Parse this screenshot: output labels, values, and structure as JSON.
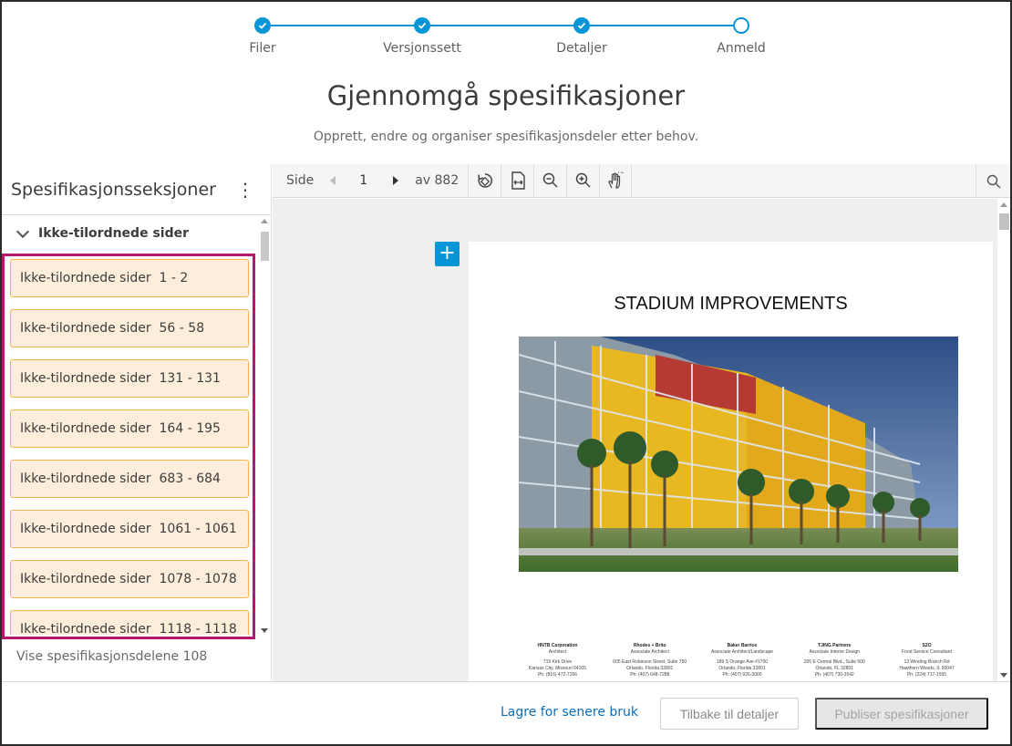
{
  "stepper": {
    "steps": [
      {
        "label": "Filer",
        "done": true
      },
      {
        "label": "Versjonssett",
        "done": true
      },
      {
        "label": "Detaljer",
        "done": true
      },
      {
        "label": "Anmeld",
        "done": false
      }
    ]
  },
  "header": {
    "title": "Gjennomgå spesifikasjoner",
    "subtitle": "Opprett, endre og organiser spesifikasjonsdeler etter behov."
  },
  "sidebar": {
    "title": "Spesifikasjonsseksjoner",
    "group_label": "Ikke-tilordnede sider",
    "items": [
      "Ikke-tilordnede sider  1 - 2",
      "Ikke-tilordnede sider  56 - 58",
      "Ikke-tilordnede sider  131 - 131",
      "Ikke-tilordnede sider  164 - 195",
      "Ikke-tilordnede sider  683 - 684",
      "Ikke-tilordnede sider  1061 - 1061",
      "Ikke-tilordnede sider  1078 - 1078",
      "Ikke-tilordnede sider  1118 - 1118"
    ],
    "count_text": "Vise spesifikasjonsdelene 108"
  },
  "viewer": {
    "page_label": "Side",
    "page_value": "1",
    "total_label": "av 882",
    "document": {
      "heading": "STADIUM IMPROVEMENTS",
      "firms": [
        {
          "name": "HNTB Corporation",
          "role": "Architect",
          "address": "715 Kirk Drive",
          "city": "Kansas City, Missouri 64105",
          "phone": "Ph: (816) 472-7266"
        },
        {
          "name": "Rhodes + Brito",
          "role": "Associate Architect",
          "address": "605 East Robinson Street, Suite 750",
          "city": "Orlando, Florida 32801",
          "phone": "Ph: (407) 648-7288"
        },
        {
          "name": "Baker Barrios",
          "role": "Associate Architect/Landscape",
          "address": "189 S Orange Ave #1700",
          "city": "Orlando, Florida 32801",
          "phone": "Ph: (407) 926-3000"
        },
        {
          "name": "TJING Partners",
          "role": "Associate Interior Design",
          "address": "205 E Central Blvd., Suite 500",
          "city": "Orlando, FL 32801",
          "phone": "Ph: (407) 730-3542"
        },
        {
          "name": "S2O",
          "role": "Food Service Consultant",
          "address": "13 Winding Branch Rd",
          "city": "Hawthorn Woods, IL 60047",
          "phone": "Ph: (224) 717-1555"
        }
      ]
    }
  },
  "footer": {
    "save_later": "Lagre for senere bruk",
    "back": "Tilbake til detaljer",
    "publish": "Publiser spesifikasjoner"
  },
  "colors": {
    "accent": "#0696d7",
    "item_bg": "#fdeedb",
    "item_border": "#f0b650",
    "highlight": "#b5196f"
  }
}
